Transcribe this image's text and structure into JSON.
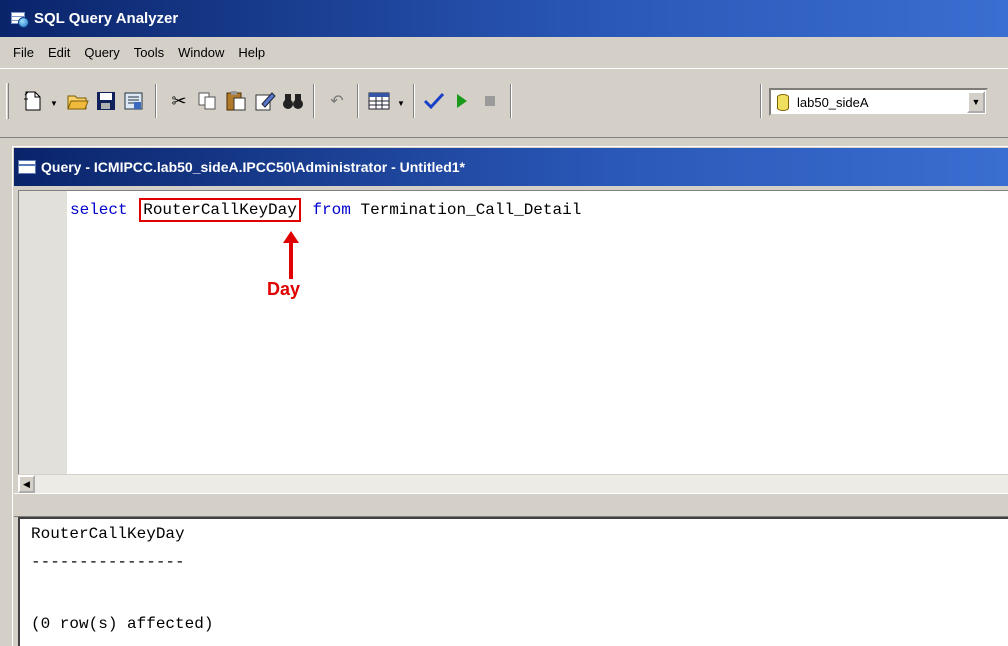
{
  "app": {
    "title": "SQL Query Analyzer"
  },
  "menu": [
    "File",
    "Edit",
    "Query",
    "Tools",
    "Window",
    "Help"
  ],
  "toolbar": {
    "database": "lab50_sideA",
    "icons": [
      "new-query-icon",
      "open-folder-icon",
      "save-icon",
      "load-script-icon",
      "cut-icon",
      "copy-icon",
      "paste-icon",
      "clear-window-icon",
      "find-icon",
      "undo-icon",
      "results-mode-icon",
      "parse-query-icon",
      "execute-icon",
      "cancel-execution-icon",
      "database-icon"
    ]
  },
  "query_window": {
    "title": "Query - ICMIPCC.lab50_sideA.IPCC50\\Administrator - Untitled1*",
    "code": {
      "keyword_select": "select",
      "column": "RouterCallKeyDay",
      "keyword_from": "from",
      "table": "Termination_Call_Detail"
    },
    "annotation": {
      "label": "Day",
      "color": "#e00000"
    }
  },
  "results": {
    "header": "RouterCallKeyDay",
    "divider": "----------------",
    "message": "(0 row(s) affected)"
  },
  "colors": {
    "titlebar": "#0a246a",
    "keyword": "#0000cc",
    "highlight": "#e00000",
    "chrome": "#d4d0c8"
  }
}
